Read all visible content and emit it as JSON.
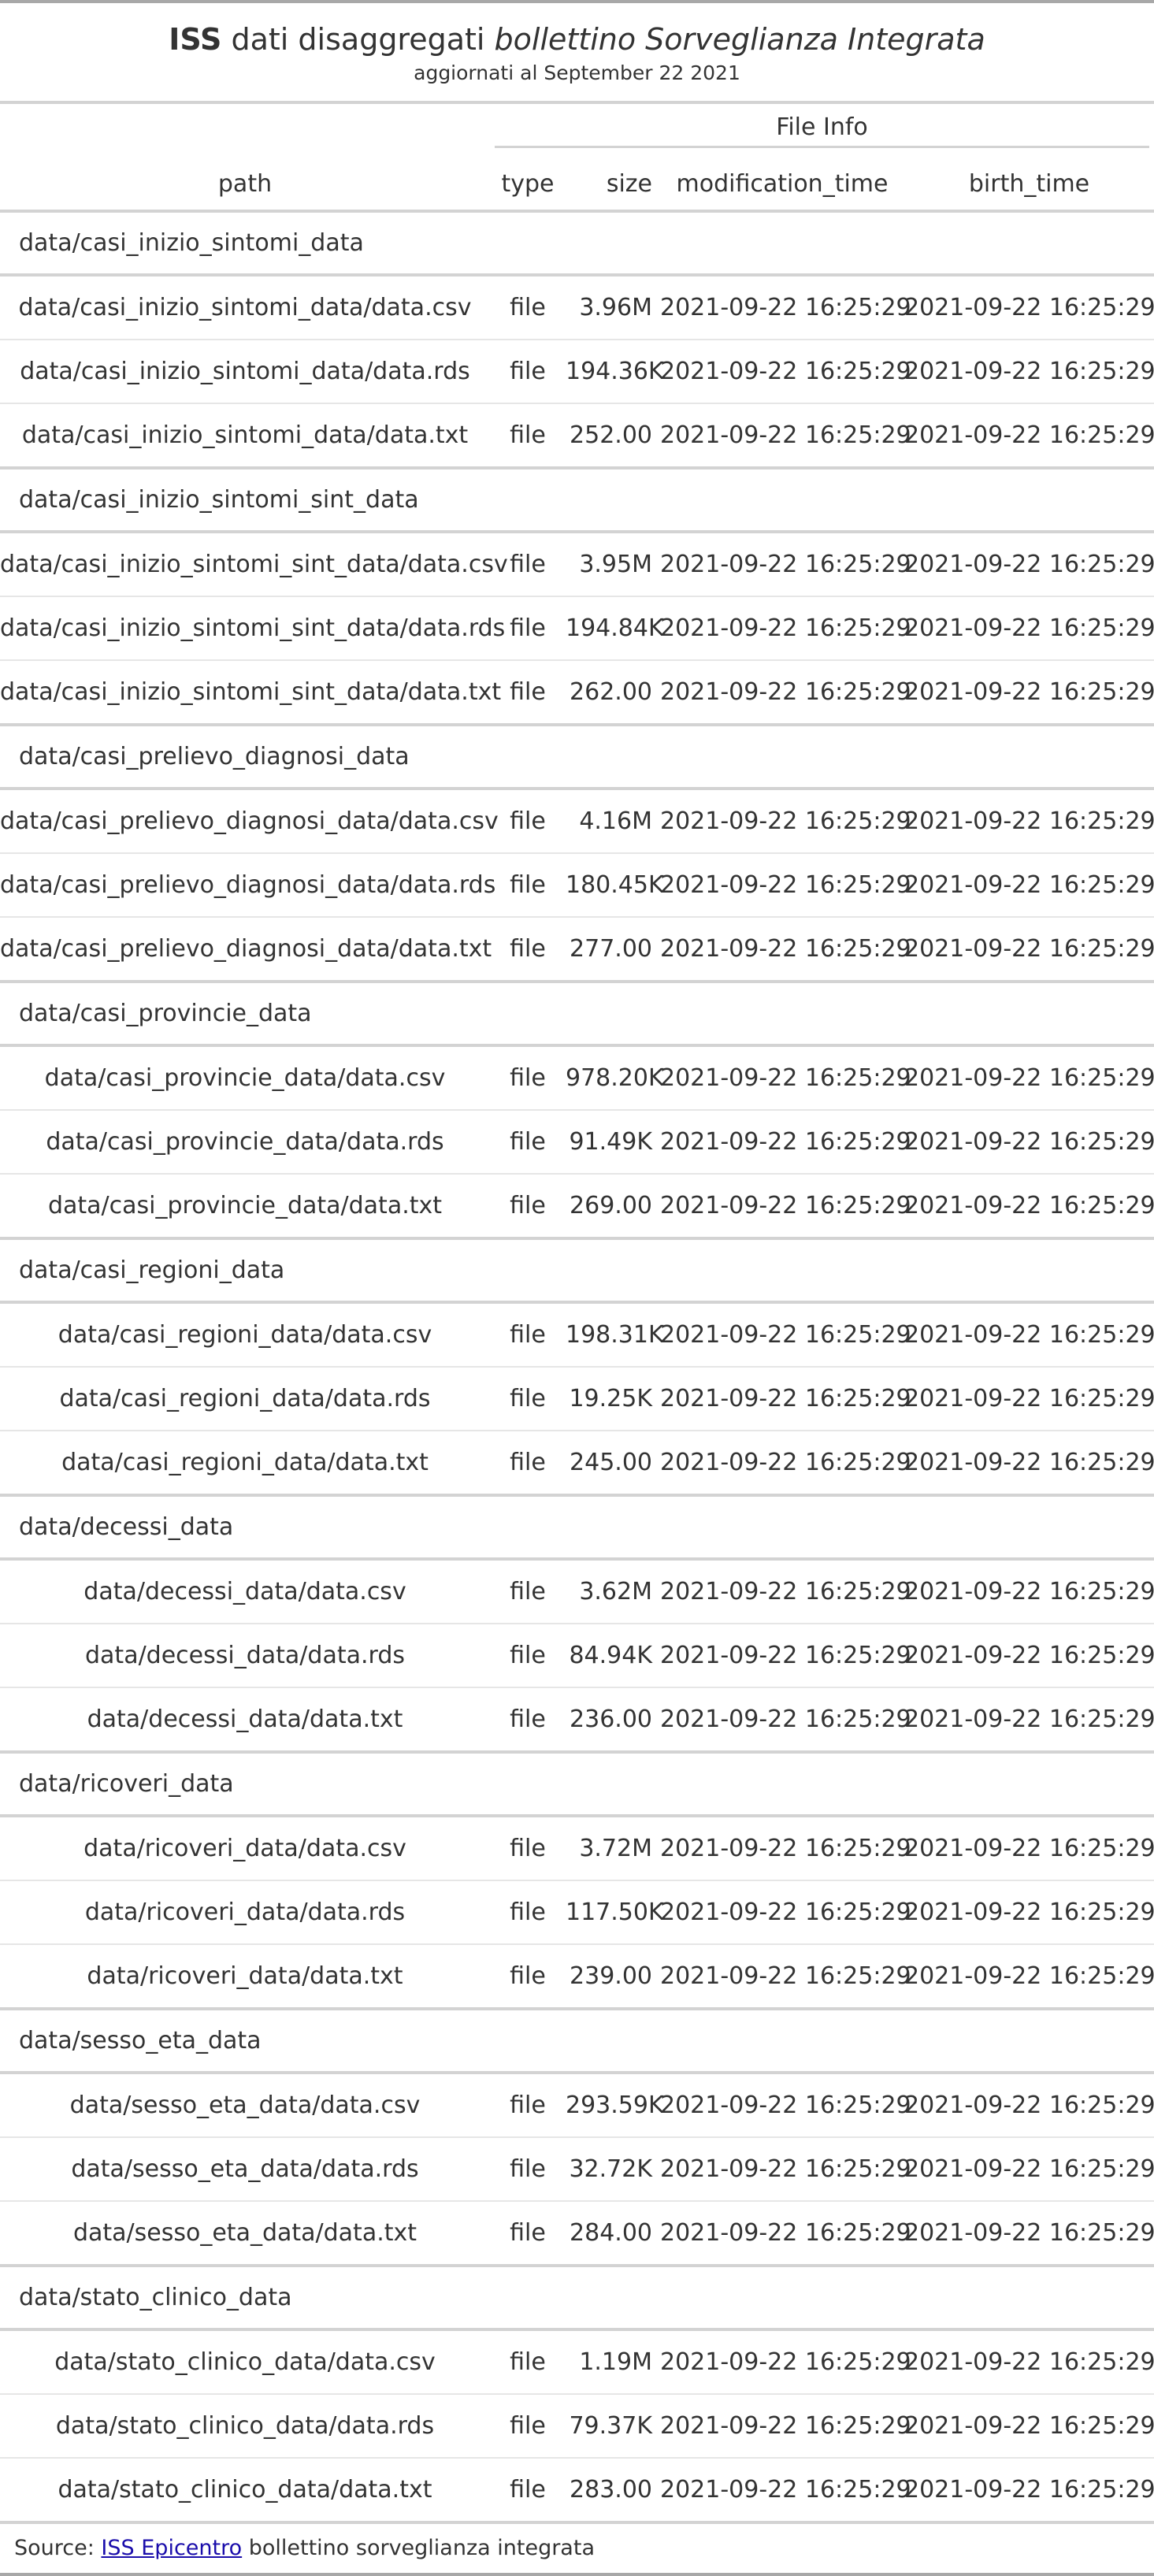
{
  "title": {
    "bold": "ISS",
    "normal": " dati disaggregati ",
    "italic": "bollettino Sorveglianza Integrata"
  },
  "subtitle": "aggiornati al September 22 2021",
  "spanner": "File Info",
  "columns": {
    "path": "path",
    "type": "type",
    "size": "size",
    "modification_time": "modification_time",
    "birth_time": "birth_time"
  },
  "groups": [
    {
      "name": "data/casi_inizio_sintomi_data",
      "rows": [
        {
          "path": "data/casi_inizio_sintomi_data/data.csv",
          "type": "file",
          "size": "3.96M",
          "mtime": "2021-09-22 16:25:29",
          "btime": "2021-09-22 16:25:29"
        },
        {
          "path": "data/casi_inizio_sintomi_data/data.rds",
          "type": "file",
          "size": "194.36K",
          "mtime": "2021-09-22 16:25:29",
          "btime": "2021-09-22 16:25:29"
        },
        {
          "path": "data/casi_inizio_sintomi_data/data.txt",
          "type": "file",
          "size": "252.00",
          "mtime": "2021-09-22 16:25:29",
          "btime": "2021-09-22 16:25:29"
        }
      ]
    },
    {
      "name": "data/casi_inizio_sintomi_sint_data",
      "rows": [
        {
          "path": "data/casi_inizio_sintomi_sint_data/data.csv",
          "type": "file",
          "size": "3.95M",
          "mtime": "2021-09-22 16:25:29",
          "btime": "2021-09-22 16:25:29"
        },
        {
          "path": "data/casi_inizio_sintomi_sint_data/data.rds",
          "type": "file",
          "size": "194.84K",
          "mtime": "2021-09-22 16:25:29",
          "btime": "2021-09-22 16:25:29"
        },
        {
          "path": "data/casi_inizio_sintomi_sint_data/data.txt",
          "type": "file",
          "size": "262.00",
          "mtime": "2021-09-22 16:25:29",
          "btime": "2021-09-22 16:25:29"
        }
      ]
    },
    {
      "name": "data/casi_prelievo_diagnosi_data",
      "rows": [
        {
          "path": "data/casi_prelievo_diagnosi_data/data.csv",
          "type": "file",
          "size": "4.16M",
          "mtime": "2021-09-22 16:25:29",
          "btime": "2021-09-22 16:25:29"
        },
        {
          "path": "data/casi_prelievo_diagnosi_data/data.rds",
          "type": "file",
          "size": "180.45K",
          "mtime": "2021-09-22 16:25:29",
          "btime": "2021-09-22 16:25:29"
        },
        {
          "path": "data/casi_prelievo_diagnosi_data/data.txt",
          "type": "file",
          "size": "277.00",
          "mtime": "2021-09-22 16:25:29",
          "btime": "2021-09-22 16:25:29"
        }
      ]
    },
    {
      "name": "data/casi_provincie_data",
      "rows": [
        {
          "path": "data/casi_provincie_data/data.csv",
          "type": "file",
          "size": "978.20K",
          "mtime": "2021-09-22 16:25:29",
          "btime": "2021-09-22 16:25:29"
        },
        {
          "path": "data/casi_provincie_data/data.rds",
          "type": "file",
          "size": "91.49K",
          "mtime": "2021-09-22 16:25:29",
          "btime": "2021-09-22 16:25:29"
        },
        {
          "path": "data/casi_provincie_data/data.txt",
          "type": "file",
          "size": "269.00",
          "mtime": "2021-09-22 16:25:29",
          "btime": "2021-09-22 16:25:29"
        }
      ]
    },
    {
      "name": "data/casi_regioni_data",
      "rows": [
        {
          "path": "data/casi_regioni_data/data.csv",
          "type": "file",
          "size": "198.31K",
          "mtime": "2021-09-22 16:25:29",
          "btime": "2021-09-22 16:25:29"
        },
        {
          "path": "data/casi_regioni_data/data.rds",
          "type": "file",
          "size": "19.25K",
          "mtime": "2021-09-22 16:25:29",
          "btime": "2021-09-22 16:25:29"
        },
        {
          "path": "data/casi_regioni_data/data.txt",
          "type": "file",
          "size": "245.00",
          "mtime": "2021-09-22 16:25:29",
          "btime": "2021-09-22 16:25:29"
        }
      ]
    },
    {
      "name": "data/decessi_data",
      "rows": [
        {
          "path": "data/decessi_data/data.csv",
          "type": "file",
          "size": "3.62M",
          "mtime": "2021-09-22 16:25:29",
          "btime": "2021-09-22 16:25:29"
        },
        {
          "path": "data/decessi_data/data.rds",
          "type": "file",
          "size": "84.94K",
          "mtime": "2021-09-22 16:25:29",
          "btime": "2021-09-22 16:25:29"
        },
        {
          "path": "data/decessi_data/data.txt",
          "type": "file",
          "size": "236.00",
          "mtime": "2021-09-22 16:25:29",
          "btime": "2021-09-22 16:25:29"
        }
      ]
    },
    {
      "name": "data/ricoveri_data",
      "rows": [
        {
          "path": "data/ricoveri_data/data.csv",
          "type": "file",
          "size": "3.72M",
          "mtime": "2021-09-22 16:25:29",
          "btime": "2021-09-22 16:25:29"
        },
        {
          "path": "data/ricoveri_data/data.rds",
          "type": "file",
          "size": "117.50K",
          "mtime": "2021-09-22 16:25:29",
          "btime": "2021-09-22 16:25:29"
        },
        {
          "path": "data/ricoveri_data/data.txt",
          "type": "file",
          "size": "239.00",
          "mtime": "2021-09-22 16:25:29",
          "btime": "2021-09-22 16:25:29"
        }
      ]
    },
    {
      "name": "data/sesso_eta_data",
      "rows": [
        {
          "path": "data/sesso_eta_data/data.csv",
          "type": "file",
          "size": "293.59K",
          "mtime": "2021-09-22 16:25:29",
          "btime": "2021-09-22 16:25:29"
        },
        {
          "path": "data/sesso_eta_data/data.rds",
          "type": "file",
          "size": "32.72K",
          "mtime": "2021-09-22 16:25:29",
          "btime": "2021-09-22 16:25:29"
        },
        {
          "path": "data/sesso_eta_data/data.txt",
          "type": "file",
          "size": "284.00",
          "mtime": "2021-09-22 16:25:29",
          "btime": "2021-09-22 16:25:29"
        }
      ]
    },
    {
      "name": "data/stato_clinico_data",
      "rows": [
        {
          "path": "data/stato_clinico_data/data.csv",
          "type": "file",
          "size": "1.19M",
          "mtime": "2021-09-22 16:25:29",
          "btime": "2021-09-22 16:25:29"
        },
        {
          "path": "data/stato_clinico_data/data.rds",
          "type": "file",
          "size": "79.37K",
          "mtime": "2021-09-22 16:25:29",
          "btime": "2021-09-22 16:25:29"
        },
        {
          "path": "data/stato_clinico_data/data.txt",
          "type": "file",
          "size": "283.00",
          "mtime": "2021-09-22 16:25:29",
          "btime": "2021-09-22 16:25:29"
        }
      ]
    }
  ],
  "footer": {
    "prefix": "Source: ",
    "link_text": "ISS Epicentro",
    "suffix": " bollettino sorveglianza integrata"
  }
}
